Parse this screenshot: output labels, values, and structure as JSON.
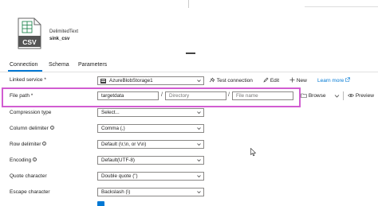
{
  "dataset": {
    "icon": "csv-file-icon",
    "icon_label": "CSV",
    "type": "DelimitedText",
    "name": "sink_csv"
  },
  "tabs": [
    {
      "label": "Connection",
      "active": true
    },
    {
      "label": "Schema",
      "active": false
    },
    {
      "label": "Parameters",
      "active": false
    }
  ],
  "linked_service": {
    "label": "Linked service",
    "required_mark": "*",
    "value": "AzureBlobStorage1",
    "test_connection": "Test connection",
    "edit": "Edit",
    "new": "New",
    "learn_more": "Learn more"
  },
  "file_path": {
    "label": "File path",
    "required_mark": "*",
    "container": "targetdata",
    "directory_placeholder": "Directory",
    "filename_placeholder": "File name",
    "separator": "/",
    "browse": "Browse",
    "preview": "Preview"
  },
  "compression_type": {
    "label": "Compression type",
    "value": "Select..."
  },
  "column_delimiter": {
    "label": "Column delimiter",
    "value": "Comma (,)"
  },
  "row_delimiter": {
    "label": "Row delimiter",
    "value": "Default (\\r,\\n, or \\r\\n)"
  },
  "encoding": {
    "label": "Encoding",
    "value": "Default(UTF-8)"
  },
  "quote_character": {
    "label": "Quote character",
    "value": "Double quote (\")"
  },
  "escape_character": {
    "label": "Escape character",
    "value": "Backslash (\\)"
  },
  "colors": {
    "accent": "#0078d4",
    "highlight": "#d15dd1"
  }
}
